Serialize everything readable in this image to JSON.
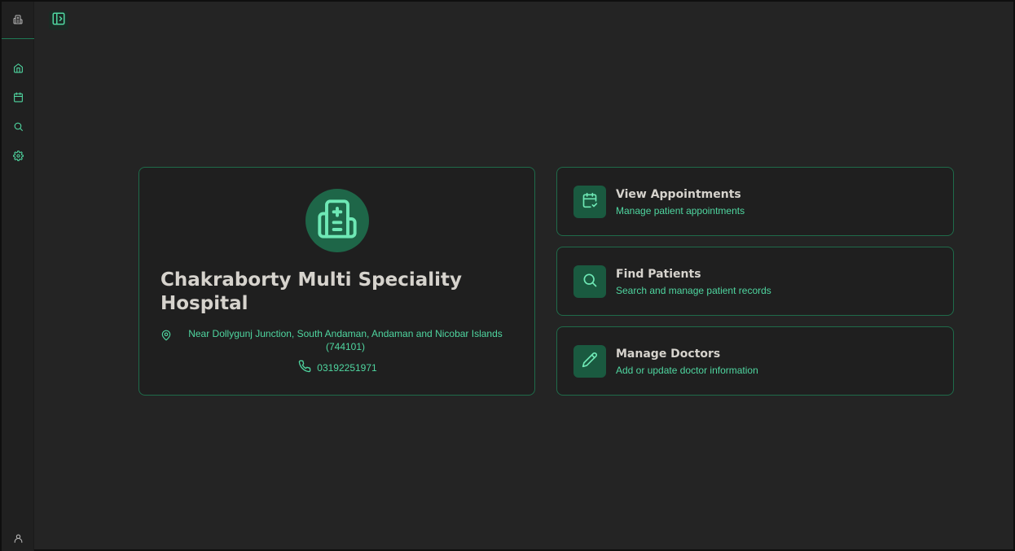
{
  "sidebar": {
    "logo_icon": "hospital-icon",
    "items": [
      {
        "name": "home",
        "icon": "home-icon"
      },
      {
        "name": "appointments",
        "icon": "calendar-icon"
      },
      {
        "name": "search",
        "icon": "search-icon"
      },
      {
        "name": "settings",
        "icon": "gear-icon"
      }
    ],
    "user_icon": "user-icon"
  },
  "header": {
    "toggle_icon": "sidebar-toggle-icon"
  },
  "hospital": {
    "name": "Chakraborty Multi Speciality Hospital",
    "address": "Near Dollygunj Junction, South Andaman, Andaman and Nicobar Islands (744101)",
    "phone": "03192251971"
  },
  "actions": [
    {
      "title": "View Appointments",
      "subtitle": "Manage patient appointments",
      "icon": "calendar-check-icon"
    },
    {
      "title": "Find Patients",
      "subtitle": "Search and manage patient records",
      "icon": "search-icon"
    },
    {
      "title": "Manage Doctors",
      "subtitle": "Add or update doctor information",
      "icon": "pencil-icon"
    }
  ],
  "colors": {
    "accent": "#4fd6a0",
    "accent_dark": "#1e6648",
    "background": "#242424",
    "card": "#1f1f1f",
    "border": "#1f6b4a",
    "text_primary": "#d6d3cd"
  }
}
